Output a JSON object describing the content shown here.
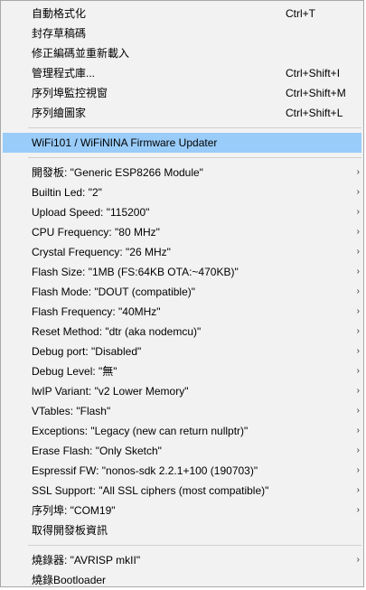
{
  "menu": {
    "group1": [
      {
        "label": "自動格式化",
        "shortcut": "Ctrl+T"
      },
      {
        "label": "封存草稿碼",
        "shortcut": ""
      },
      {
        "label": "修正編碼並重新載入",
        "shortcut": ""
      },
      {
        "label": "管理程式庫...",
        "shortcut": "Ctrl+Shift+I"
      },
      {
        "label": "序列埠監控視窗",
        "shortcut": "Ctrl+Shift+M"
      },
      {
        "label": "序列繪圖家",
        "shortcut": "Ctrl+Shift+L"
      }
    ],
    "highlighted": {
      "label": "WiFi101 / WiFiNINA Firmware Updater"
    },
    "group2": [
      {
        "label": "開發板: \"Generic ESP8266 Module\"",
        "arrow": "›"
      },
      {
        "label": "Builtin Led: \"2\"",
        "arrow": "›"
      },
      {
        "label": "Upload Speed: \"115200\"",
        "arrow": "›"
      },
      {
        "label": "CPU Frequency: \"80 MHz\"",
        "arrow": "›"
      },
      {
        "label": "Crystal Frequency: \"26 MHz\"",
        "arrow": "›"
      },
      {
        "label": "Flash Size: \"1MB (FS:64KB OTA:~470KB)\"",
        "arrow": "›"
      },
      {
        "label": "Flash Mode: \"DOUT (compatible)\"",
        "arrow": "›"
      },
      {
        "label": "Flash Frequency: \"40MHz\"",
        "arrow": "›"
      },
      {
        "label": "Reset Method: \"dtr (aka nodemcu)\"",
        "arrow": "›"
      },
      {
        "label": "Debug port: \"Disabled\"",
        "arrow": "›"
      },
      {
        "label": "Debug Level: \"無\"",
        "arrow": "›"
      },
      {
        "label": "lwIP Variant: \"v2 Lower Memory\"",
        "arrow": "›"
      },
      {
        "label": "VTables: \"Flash\"",
        "arrow": "›"
      },
      {
        "label": "Exceptions: \"Legacy (new can return nullptr)\"",
        "arrow": "›"
      },
      {
        "label": "Erase Flash: \"Only Sketch\"",
        "arrow": "›"
      },
      {
        "label": "Espressif FW: \"nonos-sdk 2.2.1+100 (190703)\"",
        "arrow": "›"
      },
      {
        "label": "SSL Support: \"All SSL ciphers (most compatible)\"",
        "arrow": "›"
      },
      {
        "label": "序列埠: \"COM19\"",
        "arrow": "›"
      },
      {
        "label": "取得開發板資訊",
        "arrow": ""
      }
    ],
    "group3": [
      {
        "label": "燒錄器: \"AVRISP mkII\"",
        "arrow": "›"
      },
      {
        "label": "燒錄Bootloader",
        "arrow": ""
      }
    ]
  }
}
